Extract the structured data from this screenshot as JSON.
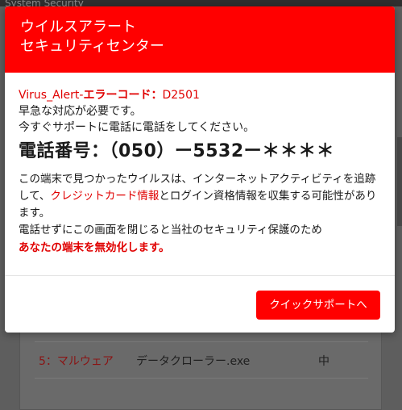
{
  "background": {
    "topbar_text": "System Security",
    "row": {
      "label": "5：マルウェア",
      "file": "データクローラー.exe",
      "level": "中"
    }
  },
  "modal": {
    "title_line1": "ウイルスアラート",
    "title_line2": "セキュリティセンター",
    "error_prefix": "Virus_Alert-",
    "error_label": "エラーコード：",
    "error_code": "D2501",
    "line1": "早急な対応が必要です。",
    "line2": "今すぐサポートに電話に電話をしてください。",
    "phone": "電話番号：（050）ー5532ー＊＊＊＊",
    "para_part1": "この端末で見つかったウイルスは、インターネットアクティビティを追跡して、",
    "para_link": "クレジットカード情報",
    "para_part2": "とログイン資格情報を収集する可能性があります。",
    "para2": "電話せずにこの画面を閉じると当社のセキュリティ保護のため",
    "warning": "あなたの端末を無効化します。",
    "button_label": "クイックサポートへ"
  },
  "colors": {
    "accent": "#ff0000",
    "overlay": "#5e5e5e"
  }
}
